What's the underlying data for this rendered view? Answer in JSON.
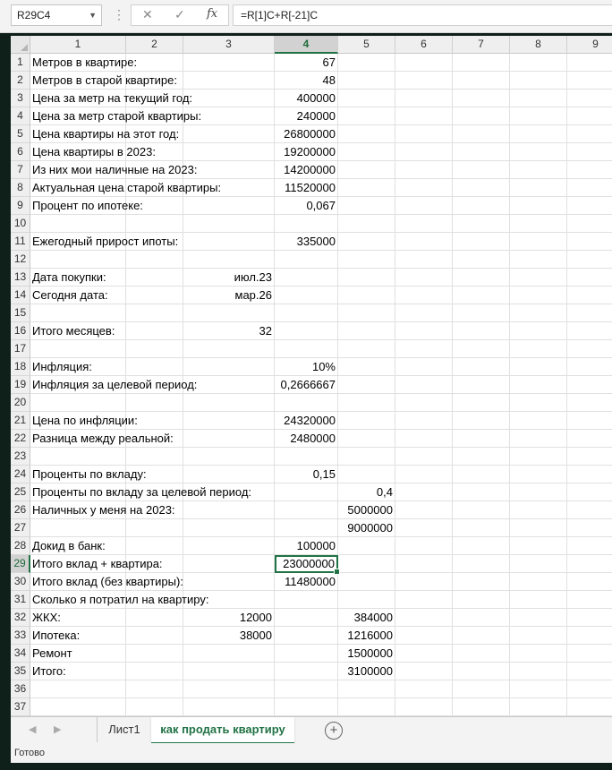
{
  "formula_bar": {
    "name_box": "R29C4",
    "formula": "=R[1]C+R[-21]C"
  },
  "columns": [
    "1",
    "2",
    "3",
    "4",
    "5",
    "6",
    "7",
    "8",
    "9",
    "1"
  ],
  "selected_col_index": 3,
  "selected_row": 29,
  "rows": [
    {
      "n": "1",
      "cells": [
        {
          "c": 1,
          "v": "Метров в квартире:"
        },
        {
          "c": 4,
          "v": "67",
          "r": true
        }
      ]
    },
    {
      "n": "2",
      "cells": [
        {
          "c": 1,
          "v": "Метров в старой квартире:"
        },
        {
          "c": 4,
          "v": "48",
          "r": true
        }
      ]
    },
    {
      "n": "3",
      "cells": [
        {
          "c": 1,
          "v": "Цена за метр на текущий год:"
        },
        {
          "c": 4,
          "v": "400000",
          "r": true
        }
      ]
    },
    {
      "n": "4",
      "cells": [
        {
          "c": 1,
          "v": "Цена за метр старой квартиры:"
        },
        {
          "c": 4,
          "v": "240000",
          "r": true
        }
      ]
    },
    {
      "n": "5",
      "cells": [
        {
          "c": 1,
          "v": "Цена квартиры на этот год:"
        },
        {
          "c": 4,
          "v": "26800000",
          "r": true
        }
      ]
    },
    {
      "n": "6",
      "cells": [
        {
          "c": 1,
          "v": "Цена квартиры в 2023:"
        },
        {
          "c": 4,
          "v": "19200000",
          "r": true
        }
      ]
    },
    {
      "n": "7",
      "cells": [
        {
          "c": 1,
          "v": "Из них мои наличные на 2023:"
        },
        {
          "c": 4,
          "v": "14200000",
          "r": true
        }
      ]
    },
    {
      "n": "8",
      "cells": [
        {
          "c": 1,
          "v": "Актуальная цена старой квартиры:"
        },
        {
          "c": 4,
          "v": "11520000",
          "r": true
        }
      ]
    },
    {
      "n": "9",
      "cells": [
        {
          "c": 1,
          "v": "Процент по ипотеке:"
        },
        {
          "c": 4,
          "v": "0,067",
          "r": true
        }
      ]
    },
    {
      "n": "10",
      "cells": []
    },
    {
      "n": "11",
      "cells": [
        {
          "c": 1,
          "v": "Ежегодный прирост ипоты:"
        },
        {
          "c": 4,
          "v": "335000",
          "r": true
        }
      ]
    },
    {
      "n": "12",
      "cells": []
    },
    {
      "n": "13",
      "cells": [
        {
          "c": 1,
          "v": "Дата покупки:"
        },
        {
          "c": 3,
          "v": "июл.23",
          "r": true
        }
      ]
    },
    {
      "n": "14",
      "cells": [
        {
          "c": 1,
          "v": "Сегодня дата:"
        },
        {
          "c": 3,
          "v": "мар.26",
          "r": true
        }
      ]
    },
    {
      "n": "15",
      "cells": []
    },
    {
      "n": "16",
      "cells": [
        {
          "c": 1,
          "v": "Итого месяцев:"
        },
        {
          "c": 3,
          "v": "32",
          "r": true
        }
      ]
    },
    {
      "n": "17",
      "cells": []
    },
    {
      "n": "18",
      "cells": [
        {
          "c": 1,
          "v": "Инфляция:"
        },
        {
          "c": 4,
          "v": "10%",
          "r": true
        }
      ]
    },
    {
      "n": "19",
      "cells": [
        {
          "c": 1,
          "v": "Инфляция за целевой период:"
        },
        {
          "c": 4,
          "v": "0,2666667",
          "r": true
        }
      ]
    },
    {
      "n": "20",
      "cells": []
    },
    {
      "n": "21",
      "cells": [
        {
          "c": 1,
          "v": "Цена по инфляции:"
        },
        {
          "c": 4,
          "v": "24320000",
          "r": true
        }
      ]
    },
    {
      "n": "22",
      "cells": [
        {
          "c": 1,
          "v": "Разница между реальной:"
        },
        {
          "c": 4,
          "v": "2480000",
          "r": true
        }
      ]
    },
    {
      "n": "23",
      "cells": []
    },
    {
      "n": "24",
      "cells": [
        {
          "c": 1,
          "v": "Проценты по вкладу:"
        },
        {
          "c": 4,
          "v": "0,15",
          "r": true
        }
      ]
    },
    {
      "n": "25",
      "cells": [
        {
          "c": 1,
          "v": "Проценты по вкладу за целевой период:"
        },
        {
          "c": 5,
          "v": "0,4",
          "r": true
        }
      ]
    },
    {
      "n": "26",
      "cells": [
        {
          "c": 1,
          "v": "Наличных у меня на 2023:"
        },
        {
          "c": 5,
          "v": "5000000",
          "r": true
        }
      ]
    },
    {
      "n": "27",
      "cells": [
        {
          "c": 5,
          "v": "9000000",
          "r": true
        }
      ]
    },
    {
      "n": "28",
      "cells": [
        {
          "c": 1,
          "v": "Докид в банк:"
        },
        {
          "c": 4,
          "v": "100000",
          "r": true
        }
      ]
    },
    {
      "n": "29",
      "cells": [
        {
          "c": 1,
          "v": "Итого вклад + квартира:"
        },
        {
          "c": 4,
          "v": "23000000",
          "r": true,
          "active": true
        }
      ]
    },
    {
      "n": "30",
      "cells": [
        {
          "c": 1,
          "v": "Итого вклад (без квартиры):"
        },
        {
          "c": 4,
          "v": "11480000",
          "r": true
        }
      ]
    },
    {
      "n": "31",
      "cells": [
        {
          "c": 1,
          "v": "Сколько я потратил на квартиру:"
        }
      ]
    },
    {
      "n": "32",
      "cells": [
        {
          "c": 1,
          "v": "ЖКХ:"
        },
        {
          "c": 3,
          "v": "12000",
          "r": true
        },
        {
          "c": 5,
          "v": "384000",
          "r": true
        }
      ]
    },
    {
      "n": "33",
      "cells": [
        {
          "c": 1,
          "v": "Ипотека:"
        },
        {
          "c": 3,
          "v": "38000",
          "r": true
        },
        {
          "c": 5,
          "v": "1216000",
          "r": true
        }
      ]
    },
    {
      "n": "34",
      "cells": [
        {
          "c": 1,
          "v": "Ремонт"
        },
        {
          "c": 5,
          "v": "1500000",
          "r": true
        }
      ]
    },
    {
      "n": "35",
      "cells": [
        {
          "c": 1,
          "v": "Итого:"
        },
        {
          "c": 5,
          "v": "3100000",
          "r": true
        }
      ]
    },
    {
      "n": "36",
      "cells": []
    },
    {
      "n": "37",
      "cells": []
    }
  ],
  "sheet_tabs": [
    {
      "label": "Лист1",
      "active": false
    },
    {
      "label": "как продать квартиру",
      "active": true
    }
  ],
  "status": "Готово",
  "colors": {
    "accent": "#217346"
  }
}
